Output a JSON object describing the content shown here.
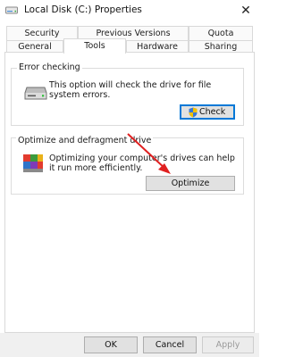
{
  "window": {
    "title": "Local Disk (C:) Properties",
    "close_glyph": "✕",
    "icon": "drive-icon"
  },
  "tabs": {
    "row1": [
      "Security",
      "Previous Versions",
      "Quota"
    ],
    "row2": [
      "General",
      "Tools",
      "Hardware",
      "Sharing"
    ],
    "active": "Tools"
  },
  "error_checking": {
    "title": "Error checking",
    "description": "This option will check the drive for file system errors.",
    "button": "Check",
    "icon": "hard-drive-icon",
    "button_icon": "shield-icon"
  },
  "optimize": {
    "title": "Optimize and defragment drive",
    "description": "Optimizing your computer's drives can help it run more efficiently.",
    "button": "Optimize",
    "icon": "defrag-icon",
    "arrow_color": "#e02020"
  },
  "footer": {
    "ok": "OK",
    "cancel": "Cancel",
    "apply": "Apply"
  }
}
